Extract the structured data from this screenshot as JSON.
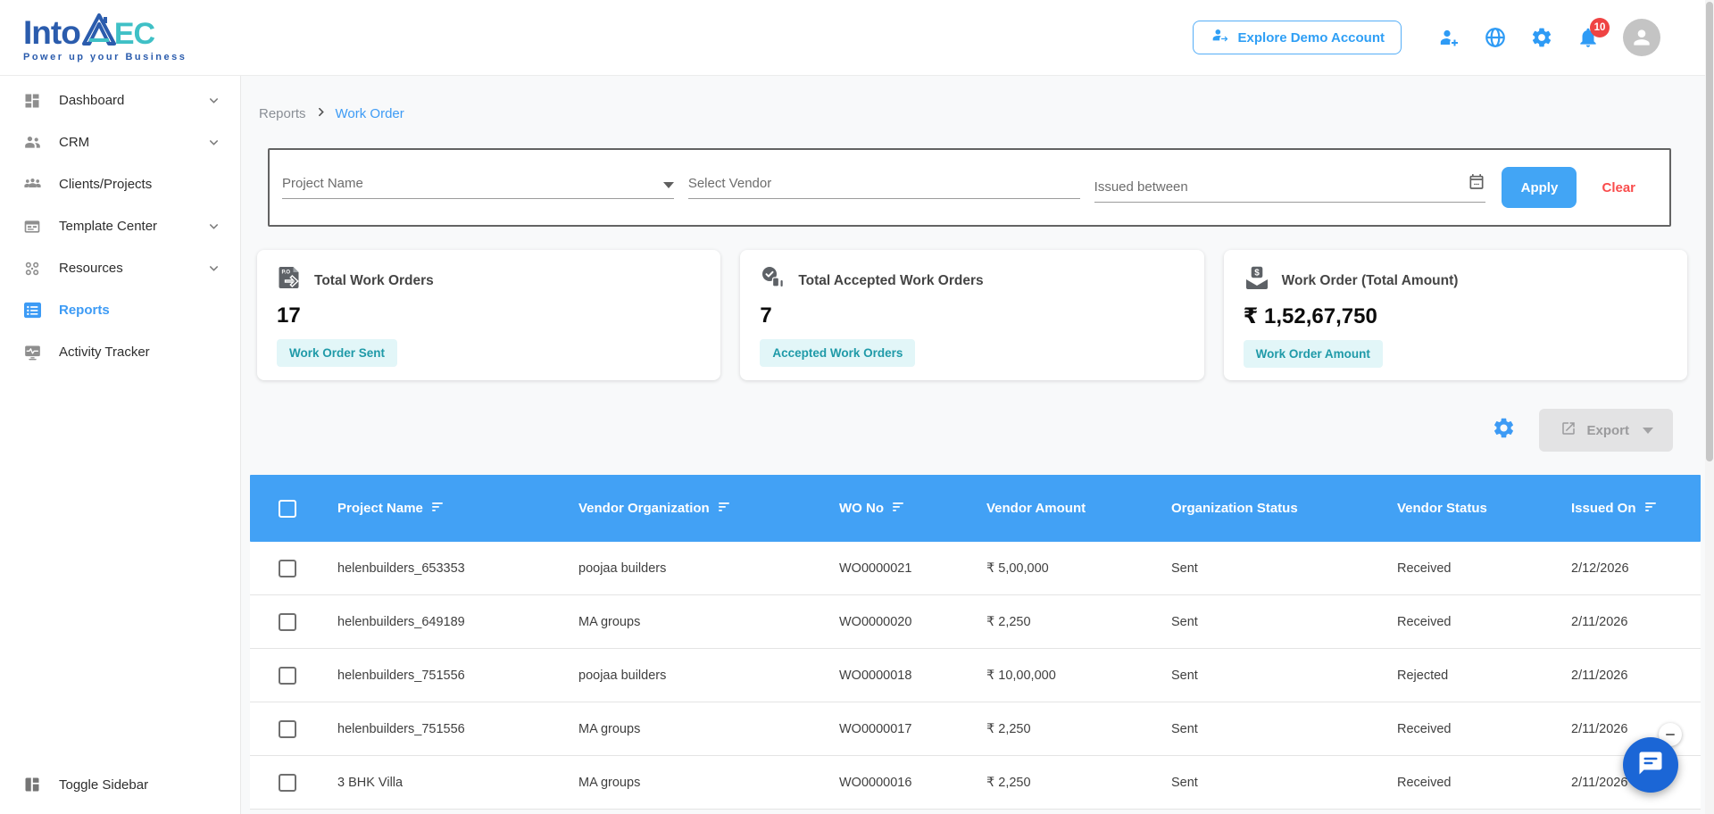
{
  "brand": {
    "display_part1": "Into",
    "display_part2": "EC",
    "tagline": "Power up your Business"
  },
  "header": {
    "explore_button_label": "Explore Demo Account",
    "notification_count": "10"
  },
  "sidebar": {
    "items": [
      {
        "label": "Dashboard"
      },
      {
        "label": "CRM"
      },
      {
        "label": "Clients/Projects"
      },
      {
        "label": "Template Center"
      },
      {
        "label": "Resources"
      },
      {
        "label": "Reports"
      },
      {
        "label": "Activity Tracker"
      }
    ],
    "toggle_label": "Toggle Sidebar"
  },
  "breadcrumb": {
    "parent": "Reports",
    "current": "Work Order"
  },
  "filterbar": {
    "project_name_placeholder": "Project Name",
    "select_vendor_placeholder": "Select Vendor",
    "issued_between_placeholder": "Issued between",
    "apply_label": "Apply",
    "clear_label": "Clear"
  },
  "stat_cards": [
    {
      "title": "Total Work Orders",
      "value": "17",
      "badge": "Work Order Sent"
    },
    {
      "title": "Total Accepted Work Orders",
      "value": "7",
      "badge": "Accepted Work Orders"
    },
    {
      "title": "Work Order (Total Amount)",
      "value": "₹ 1,52,67,750",
      "badge": "Work Order Amount"
    }
  ],
  "toolbar": {
    "export_label": "Export"
  },
  "table": {
    "columns": [
      "Project Name",
      "Vendor Organization",
      "WO No",
      "Vendor Amount",
      "Organization Status",
      "Vendor Status",
      "Issued On"
    ],
    "rows": [
      {
        "project_name": "helenbuilders_653353",
        "vendor_org": "poojaa builders",
        "wo_no": "WO0000021",
        "vendor_amount": "₹ 5,00,000",
        "org_status": "Sent",
        "vendor_status": "Received",
        "issued_on": "2/12/2026"
      },
      {
        "project_name": "helenbuilders_649189",
        "vendor_org": "MA groups",
        "wo_no": "WO0000020",
        "vendor_amount": "₹ 2,250",
        "org_status": "Sent",
        "vendor_status": "Received",
        "issued_on": "2/11/2026"
      },
      {
        "project_name": "helenbuilders_751556",
        "vendor_org": "poojaa builders",
        "wo_no": "WO0000018",
        "vendor_amount": "₹ 10,00,000",
        "org_status": "Sent",
        "vendor_status": "Rejected",
        "issued_on": "2/11/2026"
      },
      {
        "project_name": "helenbuilders_751556",
        "vendor_org": "MA groups",
        "wo_no": "WO0000017",
        "vendor_amount": "₹ 2,250",
        "org_status": "Sent",
        "vendor_status": "Received",
        "issued_on": "2/11/2026"
      },
      {
        "project_name": "3 BHK Villa",
        "vendor_org": "MA groups",
        "wo_no": "WO0000016",
        "vendor_amount": "₹ 2,250",
        "org_status": "Sent",
        "vendor_status": "Received",
        "issued_on": "2/11/2026"
      }
    ]
  },
  "colors": {
    "primary_blue": "#42a1f5",
    "link_blue": "#3d9bf5",
    "notification_red": "#ef4343",
    "clear_red": "#f94c4c",
    "badge_teal_bg": "#e2f6f8",
    "badge_teal_text": "#1f9aa8",
    "chat_blue": "#1b66d6"
  }
}
